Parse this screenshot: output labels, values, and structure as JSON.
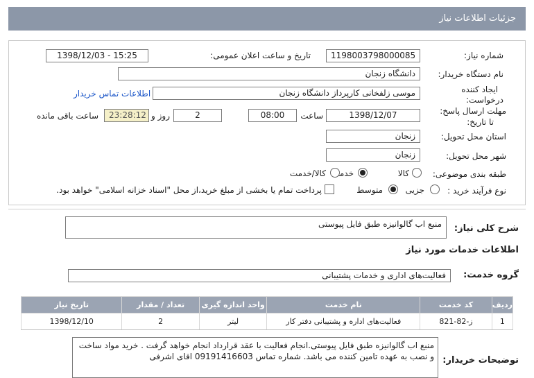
{
  "header": {
    "title": "جزئیات اطلاعات نیاز"
  },
  "form": {
    "need_number": {
      "label": "شماره نیاز:",
      "value": "1198003798000085"
    },
    "announce": {
      "label": "تاریخ و ساعت اعلان عمومی:",
      "value": "1398/12/03 - 15:25"
    },
    "buyer": {
      "label": "نام دستگاه خریدار:",
      "value": "دانشگاه زنجان"
    },
    "creator": {
      "label1": "ایجاد کننده",
      "label2": "درخواست:",
      "value": "موسی زلفخانی کارپرداز دانشگاه زنجان"
    },
    "contact_link": "اطلاعات تماس خریدار",
    "deadline": {
      "label1": "مهلت ارسال پاسخ:",
      "label2": "تا تاریخ:",
      "date": "1398/12/07",
      "hour_label": "ساعت",
      "hour": "08:00",
      "days": "2",
      "days_label": "روز و",
      "remaining": "23:28:12",
      "remaining_label": "ساعت باقی مانده"
    },
    "province": {
      "label": "استان محل تحویل:",
      "value": "زنجان"
    },
    "city": {
      "label": "شهر محل تحویل:",
      "value": "زنجان"
    },
    "category": {
      "label": "طبقه بندی موضوعی:",
      "options": [
        "کالا",
        "خدمت",
        "کالا/خدمت"
      ],
      "selected": "خدمت"
    },
    "process": {
      "label": "نوع فرآیند خرید :",
      "options": [
        "جزیی",
        "متوسط"
      ],
      "selected": "متوسط",
      "payment_note": "پرداخت تمام یا بخشی از مبلغ خرید،از محل \"اسناد خزانه اسلامی\" خواهد بود."
    }
  },
  "summary": {
    "label": "شرح کلی نیاز:",
    "value": "منبع اب گالوانیزه طبق فایل پیوستی"
  },
  "services_heading": "اطلاعات خدمات مورد نیاز",
  "service_group": {
    "label": "گروه خدمت:",
    "value": "فعالیت‌های اداری و خدمات پشتیبانی"
  },
  "table": {
    "headers": [
      "ردیف",
      "کد خدمت",
      "نام خدمت",
      "واحد اندازه گیری",
      "تعداد / مقدار",
      "تاریخ نیاز"
    ],
    "rows": [
      [
        "1",
        "ز-82-821",
        "فعالیت‌های اداره و پشتیبانی دفتر کار",
        "لیتر",
        "2",
        "1398/12/10"
      ]
    ]
  },
  "buyer_notes": {
    "label": "توضیحات خریدار:",
    "value": "منبع اب گالوانیزه طبق فایل پیوستی.انجام فعالیت با عقد قرارداد انجام خواهد گرفت . خرید مواد ساخت و نصب به عهده تامین کننده می باشد. شماره تماس 09191416603 اقای اشرفی"
  }
}
